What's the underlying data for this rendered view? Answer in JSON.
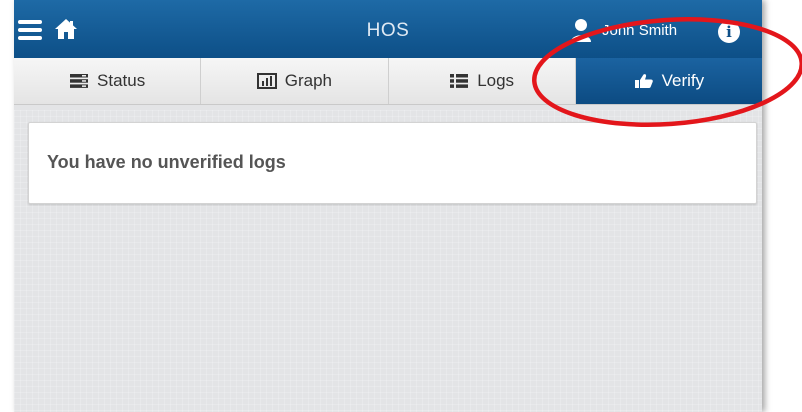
{
  "header": {
    "title": "HOS",
    "user_name": "John Smith",
    "menu_icon": "hamburger-menu-icon",
    "home_icon": "home-icon",
    "user_icon": "user-icon",
    "info_icon": "info-icon",
    "info_glyph": "i",
    "bar_color": "#0d4f87"
  },
  "tabs": [
    {
      "label": "Status",
      "icon": "status-icon",
      "active": false
    },
    {
      "label": "Graph",
      "icon": "graph-icon",
      "active": false
    },
    {
      "label": "Logs",
      "icon": "list-icon",
      "active": false
    },
    {
      "label": "Verify",
      "icon": "thumbs-up-icon",
      "active": true
    }
  ],
  "main": {
    "message": "You have no unverified logs"
  },
  "annotation": {
    "shape": "ellipse",
    "color": "#e3161b",
    "target": "Verify"
  }
}
